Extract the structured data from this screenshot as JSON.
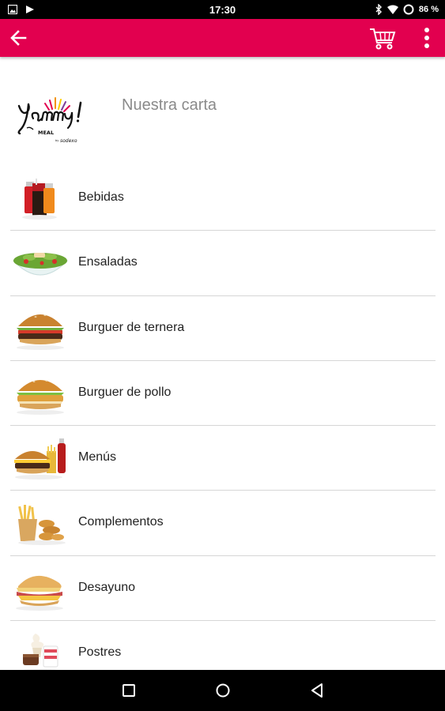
{
  "status_bar": {
    "time": "17:30",
    "battery": "86 %"
  },
  "app_bar": {
    "color": "#e2004f",
    "icons": [
      "arrow-back-icon",
      "cart-icon",
      "more-vert-icon"
    ]
  },
  "brand": {
    "title": "Nuestra carta",
    "logo_text": "Yammy! MEAL by sodexo"
  },
  "menu": {
    "items": [
      {
        "label": "Bebidas",
        "icon": "drinks-icon"
      },
      {
        "label": "Ensaladas",
        "icon": "salad-icon"
      },
      {
        "label": "Burguer de ternera",
        "icon": "beef-burger-icon"
      },
      {
        "label": "Burguer de pollo",
        "icon": "chicken-burger-icon"
      },
      {
        "label": "Menús",
        "icon": "combo-menu-icon"
      },
      {
        "label": "Complementos",
        "icon": "sides-icon"
      },
      {
        "label": "Desayuno",
        "icon": "breakfast-icon"
      },
      {
        "label": "Postres",
        "icon": "desserts-icon"
      }
    ]
  }
}
